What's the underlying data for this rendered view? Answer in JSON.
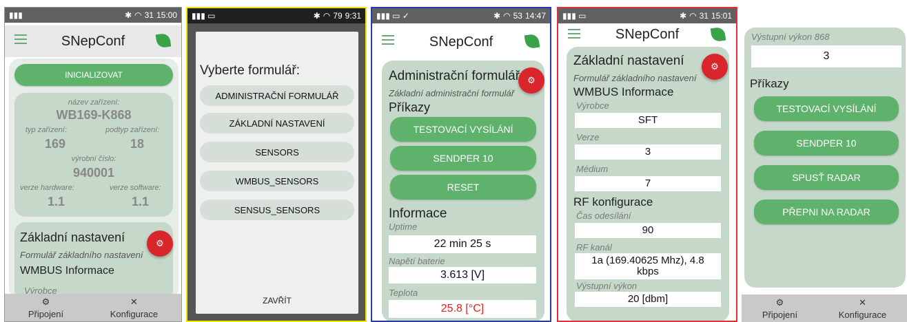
{
  "app_title": "SNepConf",
  "nav": {
    "connection": "Připojení",
    "config": "Konfigurace"
  },
  "p1": {
    "time": "15:00",
    "init_button": "INICIALIZOVAT",
    "device_name_label": "název zařízení:",
    "device_name": "WB169-K868",
    "type_label": "typ zařízení:",
    "type": "169",
    "subtype_label": "podtyp zařízení:",
    "subtype": "18",
    "serial_label": "výrobní číslo:",
    "serial": "940001",
    "hw_label": "verze hardware:",
    "hw": "1.1",
    "sw_label": "verze software:",
    "sw": "1.1",
    "basic_title": "Základní nastavení",
    "basic_subtitle": "Formulář základního nastavení",
    "wmbus_title": "WMBUS Informace",
    "maker_label": "Výrobce"
  },
  "p2": {
    "time": "9:31",
    "dialog_title": "Vyberte formulář:",
    "options": [
      "ADMINISTRAČNÍ FORMULÁŘ",
      "ZÁKLADNÍ NASTAVENÍ",
      "SENSORS",
      "WMBUS_SENSORS",
      "SENSUS_SENSORS"
    ],
    "close": "ZAVŘÍT"
  },
  "p3": {
    "time": "14:47",
    "title": "Administrační formulář",
    "subtitle": "Základní administrační formulář",
    "commands": "Příkazy",
    "buttons": [
      "TESTOVACÍ VYSÍLÁNÍ",
      "SENDPER 10",
      "RESET"
    ],
    "info_title": "Informace",
    "uptime_label": "Uptime",
    "uptime": "22 min 25 s",
    "battery_label": "Napětí baterie",
    "battery": "3.613 [V]",
    "temp_label": "Teplota",
    "temp": "25.8 [°C]",
    "temp_color": "#e02020"
  },
  "p4": {
    "time": "15:01",
    "title": "Základní nastavení",
    "subtitle": "Formulář základního nastavení",
    "wmbus_title": "WMBUS Informace",
    "maker_label": "Výrobce",
    "maker": "SFT",
    "version_label": "Verze",
    "version": "3",
    "medium_label": "Médium",
    "medium": "7",
    "rf_title": "RF konfigurace",
    "send_time_label": "Čas odesílání",
    "send_time": "90",
    "rf_channel_label": "RF kanál",
    "rf_channel": "1a (169.40625 Mhz), 4.8 kbps",
    "power_label": "Výstupní výkon",
    "power": "20 [dbm]"
  },
  "p5": {
    "power868_label": "Výstupní výkon 868",
    "power868": "3",
    "commands": "Příkazy",
    "buttons": [
      "TESTOVACÍ VYSÍLÁNÍ",
      "SENDPER 10",
      "SPUSŤ RADAR",
      "PŘEPNI NA RADAR"
    ]
  },
  "status": {
    "battery_p1": "31",
    "battery_p2": "79",
    "battery_p3": "53",
    "battery_p4": "31"
  }
}
